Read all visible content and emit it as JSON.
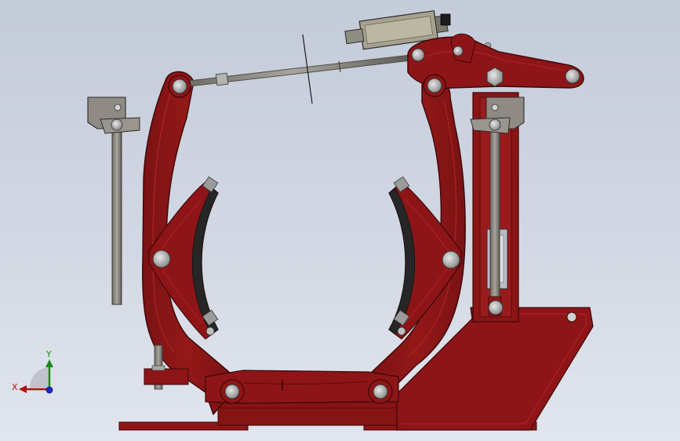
{
  "colors": {
    "background_top": "#c4cbd9",
    "background_bottom": "#e1e5ed",
    "frame": "#8e1517",
    "frame_dark": "#6c0f10",
    "frame_edge": "#3a0708",
    "steel": "#8f8b84",
    "steel_dark": "#5e5b56",
    "pin": "#c7c7c7",
    "lining": "#252525",
    "axis_x": "#b01010",
    "axis_y": "#1a8a1a",
    "axis_z": "#1a2ac8"
  },
  "icons": {
    "view_triad": "axis-triad-icon"
  },
  "triad": {
    "x_label": "X",
    "y_label": "Y"
  }
}
